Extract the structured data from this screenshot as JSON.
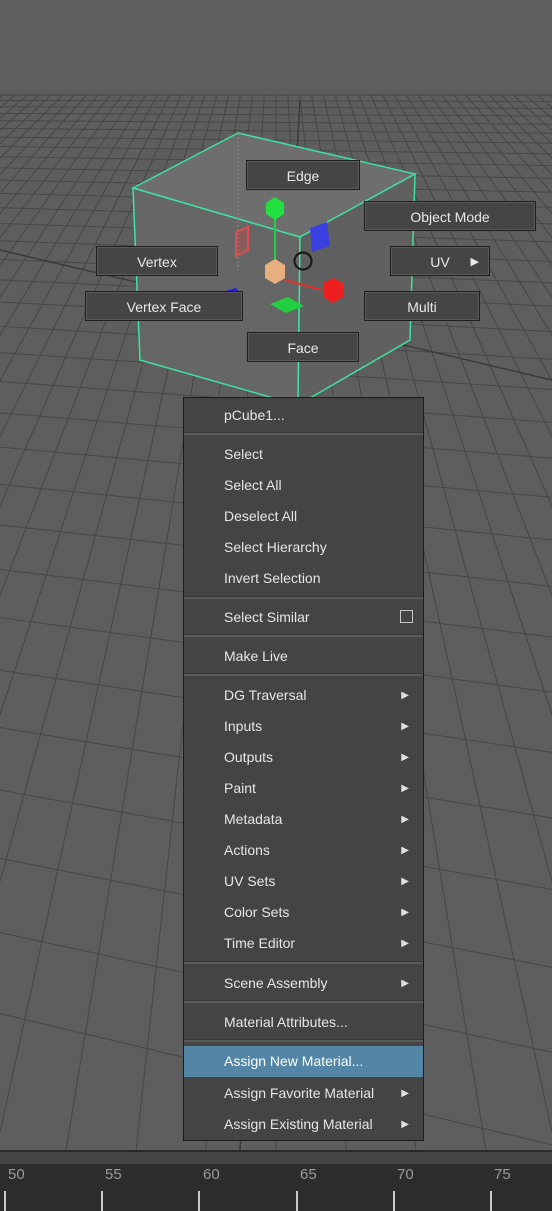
{
  "marking_menu": {
    "edge": "Edge",
    "object_mode": "Object Mode",
    "vertex": "Vertex",
    "uv": "UV",
    "vertex_face": "Vertex Face",
    "multi": "Multi",
    "face": "Face"
  },
  "context_menu": {
    "object_name": "pCube1...",
    "select": "Select",
    "select_all": "Select All",
    "deselect_all": "Deselect All",
    "select_hierarchy": "Select Hierarchy",
    "invert_selection": "Invert Selection",
    "select_similar": "Select Similar",
    "make_live": "Make Live",
    "dg_traversal": "DG Traversal",
    "inputs": "Inputs",
    "outputs": "Outputs",
    "paint": "Paint",
    "metadata": "Metadata",
    "actions": "Actions",
    "uv_sets": "UV Sets",
    "color_sets": "Color Sets",
    "time_editor": "Time Editor",
    "scene_assembly": "Scene Assembly",
    "material_attributes": "Material Attributes...",
    "assign_new_material": "Assign New Material...",
    "assign_favorite_material": "Assign Favorite Material",
    "assign_existing_material": "Assign Existing Material"
  },
  "timeline": {
    "labels": [
      "50",
      "55",
      "60",
      "65",
      "70",
      "75"
    ]
  },
  "colors": {
    "selection_wire": "#3fe0a0",
    "menu_bg": "#444444",
    "highlight": "#5285a6",
    "viewport_bg": "#5e5e5e"
  },
  "icons": [
    "submenu-arrow-icon",
    "checkbox-icon",
    "move-handle-icon"
  ]
}
